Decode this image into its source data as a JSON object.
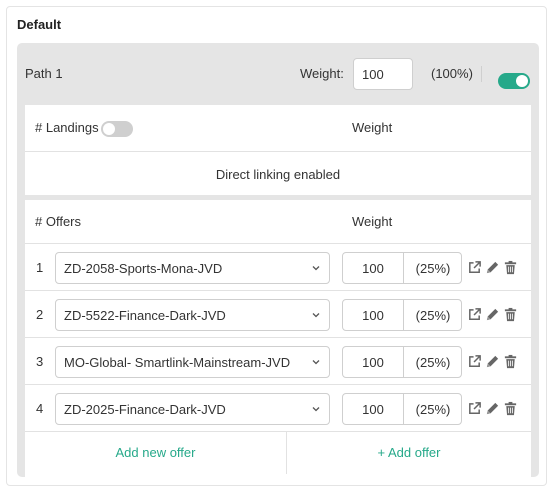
{
  "section_title": "Default",
  "path": {
    "name": "Path 1",
    "weight_label": "Weight:",
    "weight_value": "100",
    "weight_percent": "(100%)",
    "enabled": true
  },
  "landings": {
    "header_label": "# Landings",
    "header_weight": "Weight",
    "toggle_on": false,
    "direct_text": "Direct linking enabled"
  },
  "offers": {
    "header_label": "# Offers",
    "header_weight": "Weight",
    "rows": [
      {
        "num": "1",
        "name": "ZD-2058-Sports-Mona-JVD",
        "weight": "100",
        "percent": "(25%)"
      },
      {
        "num": "2",
        "name": "ZD-5522-Finance-Dark-JVD",
        "weight": "100",
        "percent": "(25%)"
      },
      {
        "num": "3",
        "name": "MO-Global- Smartlink-Mainstream-JVD",
        "weight": "100",
        "percent": "(25%)"
      },
      {
        "num": "4",
        "name": "ZD-2025-Finance-Dark-JVD",
        "weight": "100",
        "percent": "(25%)"
      }
    ],
    "add_new_label": "Add new offer",
    "add_label": "+ Add offer"
  },
  "icons": [
    "external-link-icon",
    "pencil-icon",
    "trash-icon",
    "chevron-down-icon"
  ],
  "colors": {
    "accent": "#26a98a",
    "panel_bg": "#e5e5e5",
    "toggle_off": "#cfcfcf"
  }
}
